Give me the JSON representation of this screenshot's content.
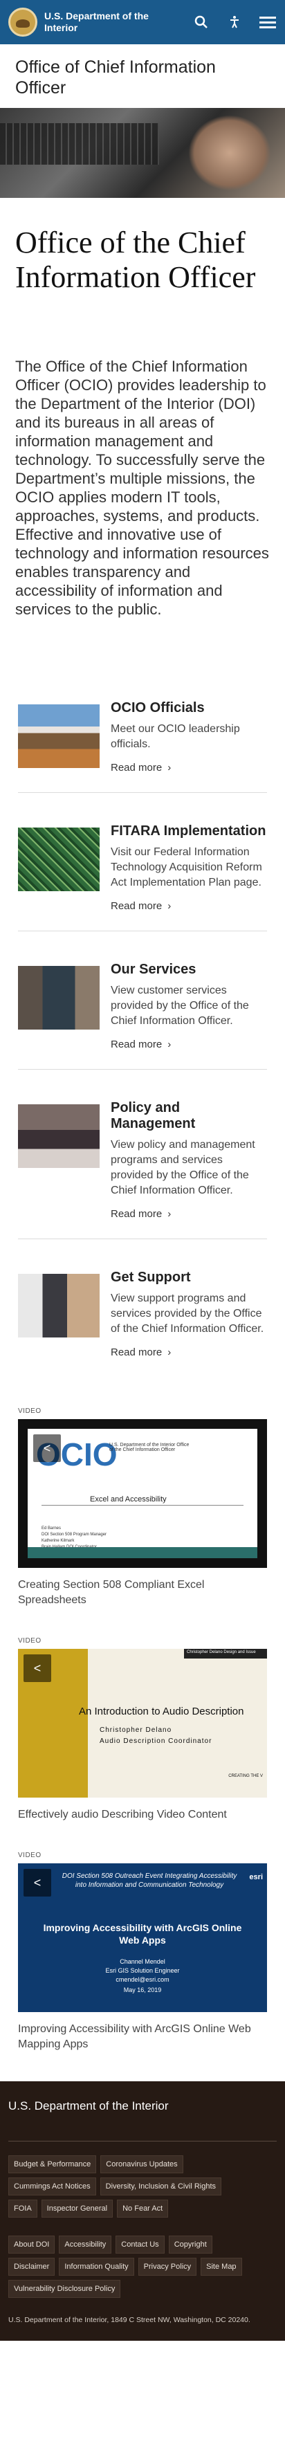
{
  "header": {
    "brand": "U.S. Department of the Interior",
    "icons": [
      "search-icon",
      "accessibility-icon",
      "menu-icon"
    ]
  },
  "site_title": "Office of Chief Information Officer",
  "page_title": "Office of the Chief Information Officer",
  "intro": "The Office of the Chief Information Officer (OCIO) provides leadership to the Department of the Interior (DOI) and its bureaus in all areas of information management and technology.  To successfully serve the Department’s multiple missions, the OCIO applies modern IT tools, approaches, systems, and products.  Effective and innovative use of technology and information resources enables transparency and accessibility of information and services to the public.",
  "cards": [
    {
      "title": "OCIO Officials",
      "desc": "Meet our OCIO leadership officials.",
      "link": "Read more"
    },
    {
      "title": "FITARA Implementation",
      "desc": "Visit our Federal Information Technology Acquisition Reform Act Implementation Plan page.",
      "link": "Read more"
    },
    {
      "title": "Our Services",
      "desc": "View customer services provided by the Office of the Chief Information Officer.",
      "link": "Read more"
    },
    {
      "title": "Policy and Management",
      "desc": "View policy and management programs and services provided by the Office of the Chief Information Officer.",
      "link": "Read more"
    },
    {
      "title": "Get Support",
      "desc": "View support programs and services provided by the Office of the Chief Information Officer.",
      "link": "Read more"
    }
  ],
  "videos": [
    {
      "label": "VIDEO",
      "caption": "Creating Section 508 Compliant Excel Spreadsheets",
      "slide": {
        "logo": "OCIO",
        "subtitle": "U.S. Department of the Interior Office of the Chief Information Officer",
        "title": "Excel and Accessibility",
        "names": "Ed Barnes\nDOI Section 508 Program Manager\nKatherine Kilmark\nBrain Hallam DOI Coordinator"
      }
    },
    {
      "label": "VIDEO",
      "caption": "Effectively audio Describing Video Content",
      "slide": {
        "top": "Christopher Delano Design and Issue",
        "title": "An Introduction to Audio Description",
        "name": "Christopher Delano",
        "role": "Audio Description Coordinator",
        "bottom": "CREATING THE V"
      }
    },
    {
      "label": "VIDEO",
      "caption": "Improving Accessibility with ArcGIS Online Web Mapping Apps",
      "slide": {
        "event": "DOI Section 508 Outreach Event Integrating Accessibility into Information and Communication Technology",
        "brand": "esri",
        "title": "Improving Accessibility with ArcGIS Online Web Apps",
        "presenter": "Channel Mendel\nEsri GIS Solution Engineer\ncmendel@esri.com",
        "date": "May 16, 2019"
      }
    }
  ],
  "footer": {
    "title": "U.S. Department of the Interior",
    "links_top": [
      "Budget & Performance",
      "Coronavirus Updates",
      "Cummings Act Notices",
      "Diversity, Inclusion & Civil Rights",
      "FOIA",
      "Inspector General",
      "No Fear Act"
    ],
    "links_bottom": [
      "About DOI",
      "Accessibility",
      "Contact Us",
      "Copyright",
      "Disclaimer",
      "Information Quality",
      "Privacy Policy",
      "Site Map",
      "Vulnerability Disclosure Policy"
    ],
    "address": "U.S. Department of the Interior, 1849 C Street NW, Washington, DC 20240."
  }
}
